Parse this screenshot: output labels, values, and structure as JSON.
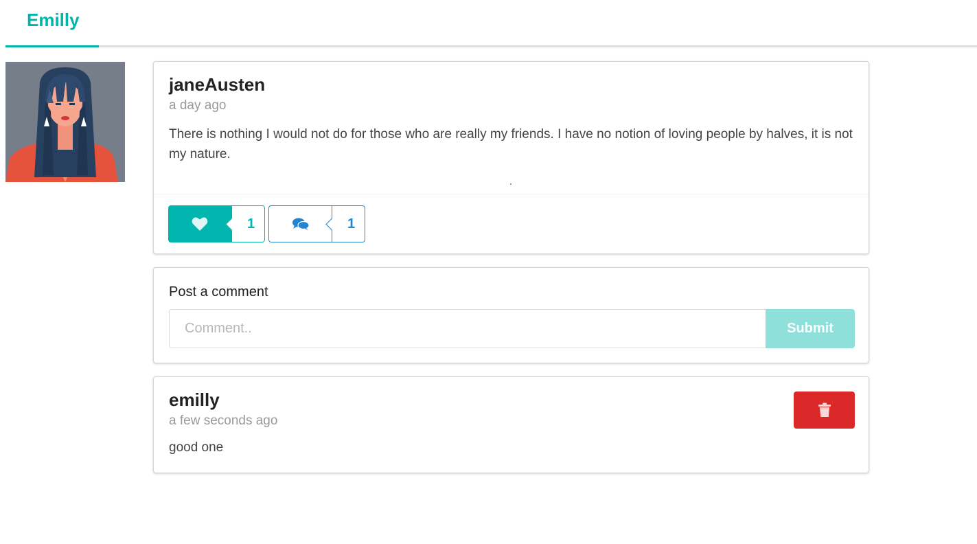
{
  "header": {
    "active_tab": "Emilly"
  },
  "avatar": {
    "icon": "woman-avatar-illustration"
  },
  "post": {
    "author": "janeAusten",
    "time": "a day ago",
    "text": "There is nothing I would not do for those who are really my friends. I have no notion of loving people by halves, it is not my nature.",
    "likes": "1",
    "comments": "1",
    "like_icon": "heart-icon",
    "comment_icon": "comments-icon"
  },
  "comment_form": {
    "label": "Post a comment",
    "placeholder": "Comment..",
    "value": "",
    "submit_label": "Submit"
  },
  "comments": [
    {
      "author": "emilly",
      "time": "a few seconds ago",
      "text": "good one",
      "delete_icon": "trash-icon"
    }
  ],
  "colors": {
    "accent_teal": "#00b5ad",
    "accent_blue": "#2185d0",
    "submit_light_teal": "#8fdfda",
    "delete_red": "#db2828"
  }
}
